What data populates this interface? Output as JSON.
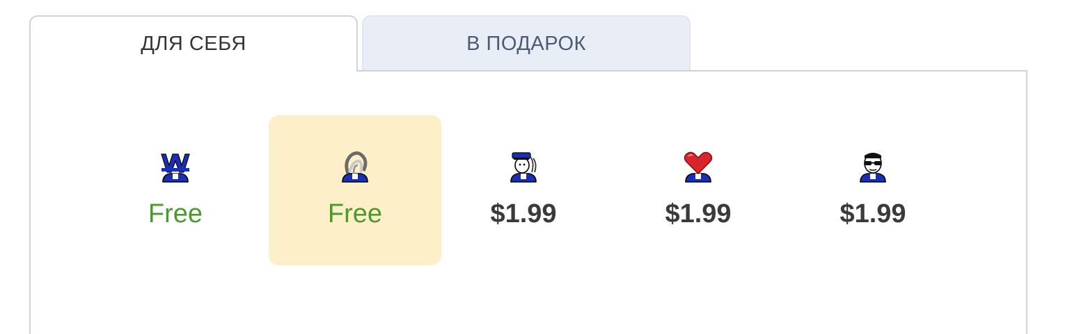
{
  "tabs": [
    {
      "label": "ДЛЯ СЕБЯ",
      "active": true
    },
    {
      "label": "В ПОДАРОК",
      "active": false
    }
  ],
  "items": [
    {
      "icon": "letter-w-user-icon",
      "price": "Free",
      "selected": false
    },
    {
      "icon": "hair-user-icon",
      "price": "Free",
      "selected": true
    },
    {
      "icon": "police-officer-user-icon",
      "price": "$1.99",
      "selected": false
    },
    {
      "icon": "heart-user-icon",
      "price": "$1.99",
      "selected": false
    },
    {
      "icon": "sunglasses-user-icon",
      "price": "$1.99",
      "selected": false
    }
  ],
  "colors": {
    "free_price": "#4b9a2c",
    "paid_price": "#3a3a3a",
    "selected_bg": "#fdefc7",
    "inactive_tab_bg": "#e9eef6"
  }
}
